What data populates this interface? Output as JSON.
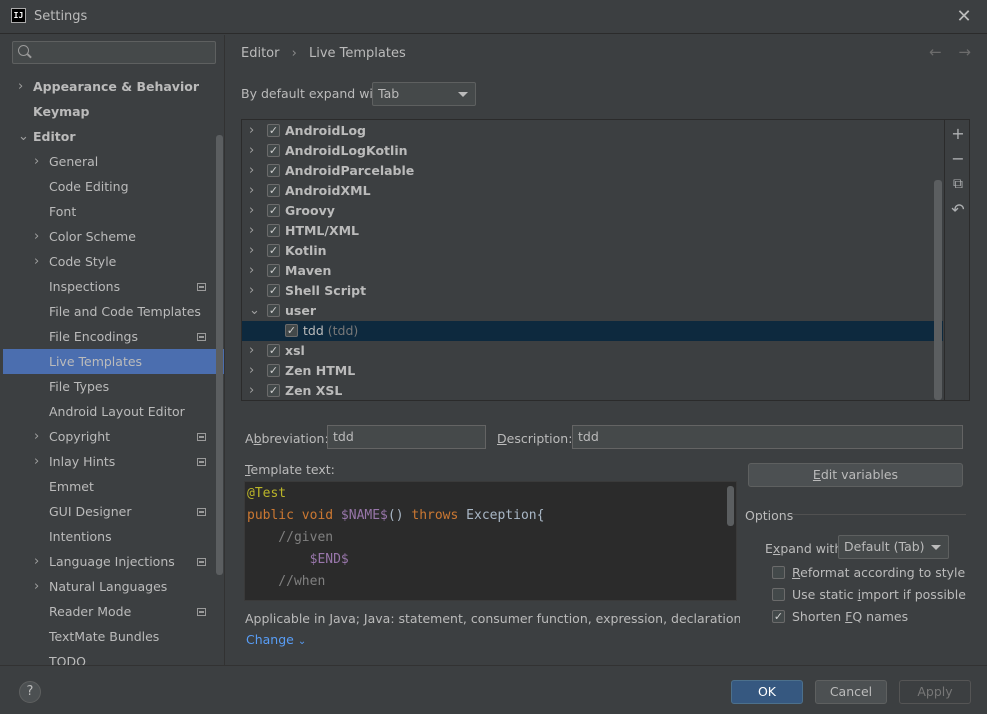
{
  "window": {
    "title": "Settings",
    "app_icon": "intellij-icon",
    "close": "✕"
  },
  "search": {
    "placeholder": ""
  },
  "sidebar": {
    "items": [
      {
        "label": "Appearance & Behavior",
        "level": 0,
        "arrow": "›",
        "bold": true,
        "badge": false
      },
      {
        "label": "Keymap",
        "level": 0,
        "arrow": "",
        "bold": true,
        "badge": false
      },
      {
        "label": "Editor",
        "level": 0,
        "arrow": "⌄",
        "bold": true,
        "badge": false
      },
      {
        "label": "General",
        "level": 1,
        "arrow": "›",
        "bold": false,
        "badge": false
      },
      {
        "label": "Code Editing",
        "level": 1,
        "arrow": "",
        "bold": false,
        "badge": false
      },
      {
        "label": "Font",
        "level": 1,
        "arrow": "",
        "bold": false,
        "badge": false
      },
      {
        "label": "Color Scheme",
        "level": 1,
        "arrow": "›",
        "bold": false,
        "badge": false
      },
      {
        "label": "Code Style",
        "level": 1,
        "arrow": "›",
        "bold": false,
        "badge": false
      },
      {
        "label": "Inspections",
        "level": 1,
        "arrow": "",
        "bold": false,
        "badge": true
      },
      {
        "label": "File and Code Templates",
        "level": 1,
        "arrow": "",
        "bold": false,
        "badge": false
      },
      {
        "label": "File Encodings",
        "level": 1,
        "arrow": "",
        "bold": false,
        "badge": true
      },
      {
        "label": "Live Templates",
        "level": 1,
        "arrow": "",
        "bold": false,
        "badge": false,
        "selected": true
      },
      {
        "label": "File Types",
        "level": 1,
        "arrow": "",
        "bold": false,
        "badge": false
      },
      {
        "label": "Android Layout Editor",
        "level": 1,
        "arrow": "",
        "bold": false,
        "badge": false
      },
      {
        "label": "Copyright",
        "level": 1,
        "arrow": "›",
        "bold": false,
        "badge": true
      },
      {
        "label": "Inlay Hints",
        "level": 1,
        "arrow": "›",
        "bold": false,
        "badge": true
      },
      {
        "label": "Emmet",
        "level": 1,
        "arrow": "",
        "bold": false,
        "badge": false
      },
      {
        "label": "GUI Designer",
        "level": 1,
        "arrow": "",
        "bold": false,
        "badge": true
      },
      {
        "label": "Intentions",
        "level": 1,
        "arrow": "",
        "bold": false,
        "badge": false
      },
      {
        "label": "Language Injections",
        "level": 1,
        "arrow": "›",
        "bold": false,
        "badge": true
      },
      {
        "label": "Natural Languages",
        "level": 1,
        "arrow": "›",
        "bold": false,
        "badge": false
      },
      {
        "label": "Reader Mode",
        "level": 1,
        "arrow": "",
        "bold": false,
        "badge": true
      },
      {
        "label": "TextMate Bundles",
        "level": 1,
        "arrow": "",
        "bold": false,
        "badge": false
      },
      {
        "label": "TODO",
        "level": 1,
        "arrow": "",
        "bold": false,
        "badge": false
      }
    ]
  },
  "breadcrumb": {
    "parent": "Editor",
    "separator": "›",
    "current": "Live Templates"
  },
  "nav": {
    "back": "←",
    "forward": "→"
  },
  "expand_with": {
    "label": "By default expand with",
    "value": "Tab"
  },
  "templates": [
    {
      "name": "AndroidLog",
      "sub": "",
      "checked": true,
      "expanded": false,
      "level": 0
    },
    {
      "name": "AndroidLogKotlin",
      "sub": "",
      "checked": true,
      "expanded": false,
      "level": 0
    },
    {
      "name": "AndroidParcelable",
      "sub": "",
      "checked": true,
      "expanded": false,
      "level": 0
    },
    {
      "name": "AndroidXML",
      "sub": "",
      "checked": true,
      "expanded": false,
      "level": 0
    },
    {
      "name": "Groovy",
      "sub": "",
      "checked": true,
      "expanded": false,
      "level": 0
    },
    {
      "name": "HTML/XML",
      "sub": "",
      "checked": true,
      "expanded": false,
      "level": 0
    },
    {
      "name": "Kotlin",
      "sub": "",
      "checked": true,
      "expanded": false,
      "level": 0
    },
    {
      "name": "Maven",
      "sub": "",
      "checked": true,
      "expanded": false,
      "level": 0
    },
    {
      "name": "Shell Script",
      "sub": "",
      "checked": true,
      "expanded": false,
      "level": 0
    },
    {
      "name": "user",
      "sub": "",
      "checked": true,
      "expanded": true,
      "level": 0
    },
    {
      "name": "tdd",
      "sub": "(tdd)",
      "checked": true,
      "expanded": false,
      "level": 1,
      "selected": true
    },
    {
      "name": "xsl",
      "sub": "",
      "checked": true,
      "expanded": false,
      "level": 0
    },
    {
      "name": "Zen HTML",
      "sub": "",
      "checked": true,
      "expanded": false,
      "level": 0
    },
    {
      "name": "Zen XSL",
      "sub": "",
      "checked": true,
      "expanded": false,
      "level": 0
    }
  ],
  "list_tools": {
    "add": "+",
    "remove": "−",
    "copy": "⧉",
    "restore": "↶"
  },
  "abbreviation": {
    "label_pre": "A",
    "label_u": "b",
    "label_post": "breviation:",
    "value": "tdd"
  },
  "description": {
    "label_u": "D",
    "label_post": "escription:",
    "value": "tdd"
  },
  "template_text": {
    "label_u": "T",
    "label_post": "emplate text:"
  },
  "code": {
    "line1": "@Test",
    "line2_kw1": "public void ",
    "line2_var": "$NAME$",
    "line2_mid": "() ",
    "line2_kw2": "throws ",
    "line2_end": "Exception{",
    "line3": "    //given",
    "line4": "        $END$",
    "line5": "    //when"
  },
  "edit_variables": {
    "label_u": "E",
    "label_post": "dit variables"
  },
  "options": {
    "title": "Options",
    "expand_label_pre": "E",
    "expand_label_u": "x",
    "expand_label_post": "pand with",
    "expand_value": "Default (Tab)",
    "reformat": {
      "pre": "",
      "u": "R",
      "post": "eformat according to style",
      "checked": false
    },
    "static_import": {
      "pre": "Use static ",
      "u": "i",
      "post": "mport if possible",
      "checked": false
    },
    "shorten": {
      "pre": "Shorten ",
      "u": "F",
      "post": "Q names",
      "checked": true
    }
  },
  "applicable": "Applicable in Java; Java: statement, consumer function, expression, declaration, comment...",
  "change_link": "Change",
  "footer": {
    "help": "?",
    "ok": "OK",
    "cancel": "Cancel",
    "apply": "Apply"
  }
}
